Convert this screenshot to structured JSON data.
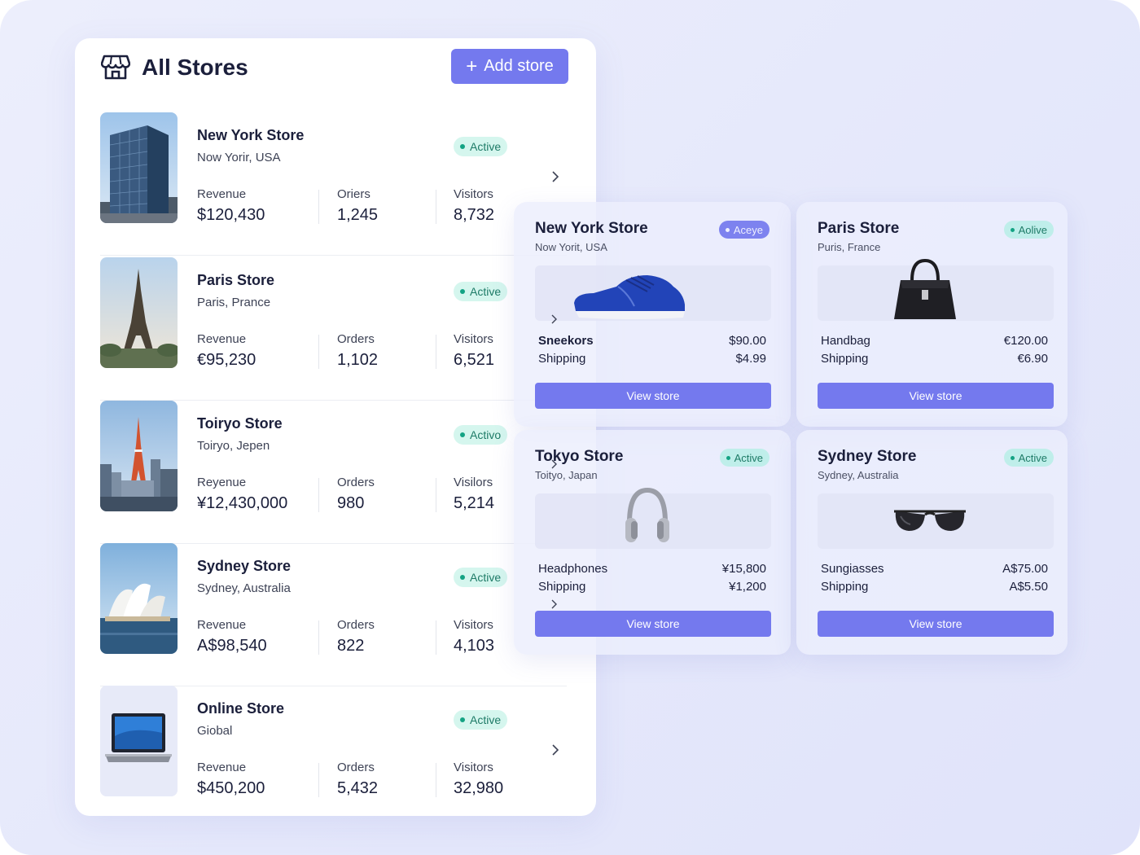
{
  "header": {
    "title": "All Stores",
    "add_button_label": "Add store",
    "add_button_icon": "plus-icon",
    "title_icon": "store-icon"
  },
  "stores": [
    {
      "name": "New York Store",
      "location": "Now Yorir, USA",
      "status": "Active",
      "revenue_label": "Revenue",
      "revenue": "$120,430",
      "orders_label": "Oriers",
      "orders": "1,245",
      "visitors_label": "Visitors",
      "visitors": "8,732",
      "thumbnail": "skyscraper-image"
    },
    {
      "name": "Paris Store",
      "location": "Paris, Prance",
      "status": "Active",
      "revenue_label": "Revenue",
      "revenue": "€95,230",
      "orders_label": "Orders",
      "orders": "1,102",
      "visitors_label": "Visitors",
      "visitors": "6,521",
      "thumbnail": "eiffel-tower-image"
    },
    {
      "name": "Toiryo Store",
      "location": "Toiryo, Jepen",
      "status": "Activo",
      "revenue_label": "Reyenue",
      "revenue": "¥12,430,000",
      "orders_label": "Orders",
      "orders": "980",
      "visitors_label": "Visilors",
      "visitors": "5,214",
      "thumbnail": "tokyo-tower-image"
    },
    {
      "name": "Sydney Store",
      "location": "Sydney, Australia",
      "status": "Active",
      "revenue_label": "Revenue",
      "revenue": "A$98,540",
      "orders_label": "Orders",
      "orders": "822",
      "visitors_label": "Visitors",
      "visitors": "4,103",
      "thumbnail": "opera-house-image"
    },
    {
      "name": "Online Store",
      "location": "Giobal",
      "status": "Active",
      "revenue_label": "Revenue",
      "revenue": "$450,200",
      "orders_label": "Orders",
      "orders": "5,432",
      "visitors_label": "Visitors",
      "visitors": "32,980",
      "thumbnail": "laptop-image"
    }
  ],
  "cards": [
    {
      "name": "New York Store",
      "location": "Now Yorit, USA",
      "status": "Aceye",
      "product": "Sneekors",
      "price": "$90.00",
      "shipping_label": "Shipping",
      "shipping": "$4.99",
      "button": "View store",
      "image": "sneaker-icon"
    },
    {
      "name": "Paris Store",
      "location": "Puris, France",
      "status": "Aolive",
      "product": "Handbag",
      "price": "€120.00",
      "shipping_label": "Shipping",
      "shipping": "€6.90",
      "button": "View store",
      "image": "handbag-icon"
    },
    {
      "name": "Tokyo Store",
      "location": "Toityo, Japan",
      "status": "Active",
      "product": "Headphones",
      "price": "¥15,800",
      "shipping_label": "Shipping",
      "shipping": "¥1,200",
      "button": "View store",
      "image": "headphones-icon"
    },
    {
      "name": "Sydney Store",
      "location": "Sydney, Australia",
      "status": "Active",
      "product": "Sungiasses",
      "price": "A$75.00",
      "shipping_label": "Shipping",
      "shipping": "A$5.50",
      "button": "View store",
      "image": "sunglasses-icon"
    }
  ],
  "colors": {
    "accent": "#7479ee",
    "active_badge_bg": "#d5f6ee",
    "active_badge_text": "#1e7b67",
    "background": "#e8eafc"
  }
}
